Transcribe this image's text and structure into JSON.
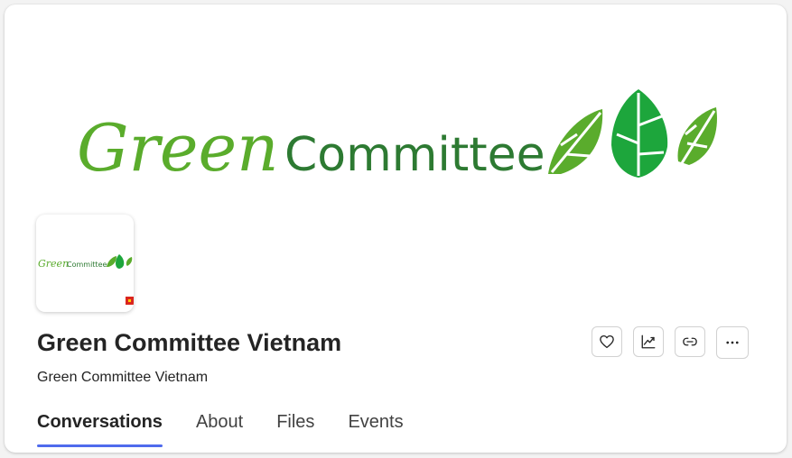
{
  "banner": {
    "logo_word1": "Green",
    "logo_word2": "Committee",
    "color_light_green": "#5aac2c",
    "color_dark_green": "#2d7a32"
  },
  "team": {
    "name": "Green Committee Vietnam",
    "description": "Green Committee Vietnam"
  },
  "actions": [
    {
      "icon": "heart-icon",
      "label": "Favorite"
    },
    {
      "icon": "analytics-icon",
      "label": "Analytics"
    },
    {
      "icon": "link-icon",
      "label": "Copy link"
    },
    {
      "icon": "more-icon",
      "label": "More options"
    }
  ],
  "tabs": [
    {
      "label": "Conversations",
      "active": true
    },
    {
      "label": "About",
      "active": false
    },
    {
      "label": "Files",
      "active": false
    },
    {
      "label": "Events",
      "active": false
    }
  ],
  "colors": {
    "accent": "#4f6bed",
    "text": "#242424"
  }
}
